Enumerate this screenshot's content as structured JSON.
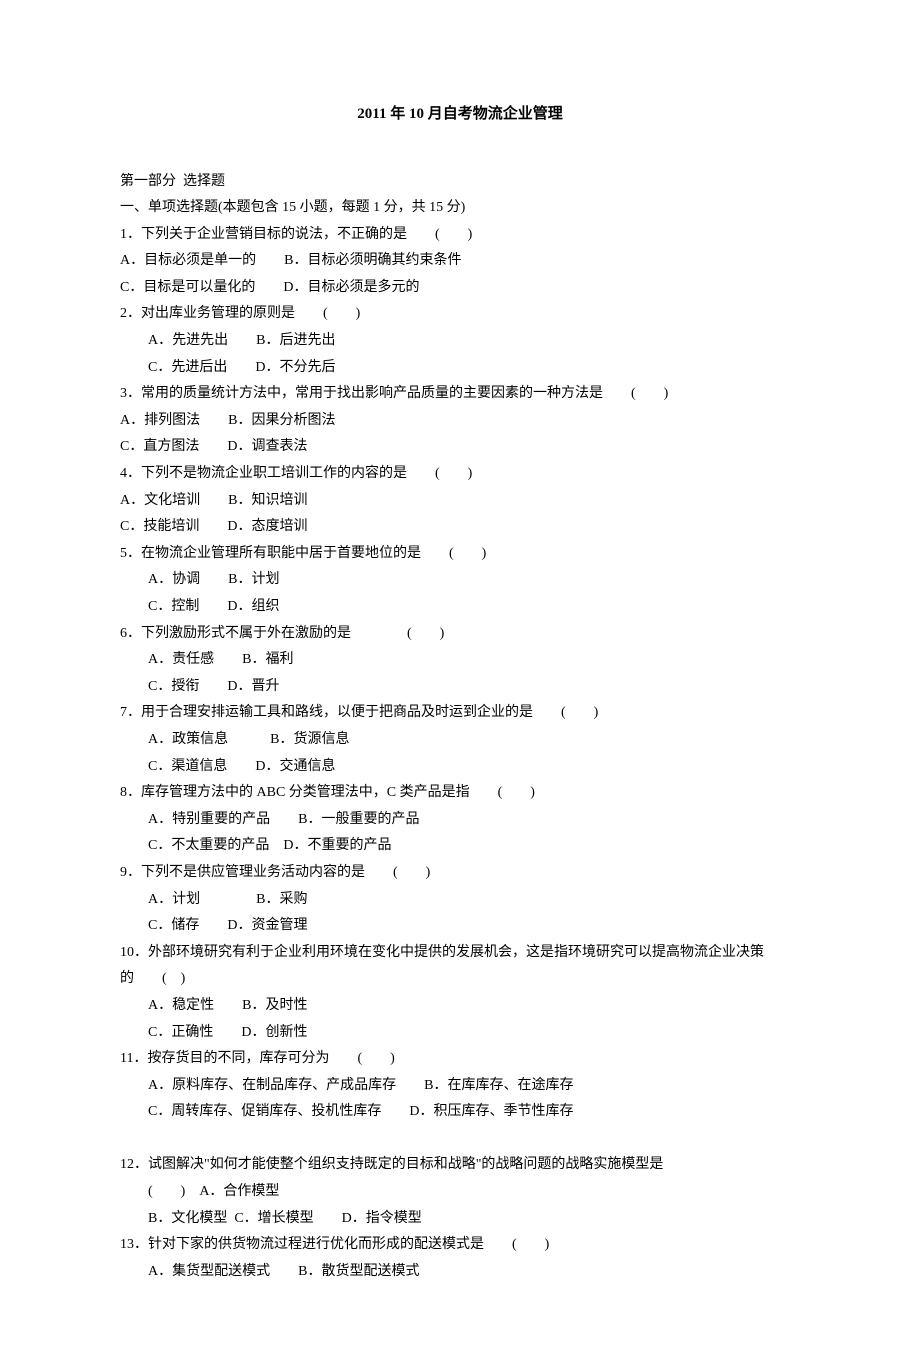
{
  "title": "2011 年 10 月自考物流企业管理",
  "part_header": "第一部分  选择题",
  "section1_header": "一、单项选择题(本题包含 15 小题，每题 1 分，共 15 分)",
  "q1": {
    "stem": "1．下列关于企业营销目标的说法，不正确的是　　(　　)",
    "line1": "A．目标必须是单一的　　B．目标必须明确其约束条件",
    "line2": "C．目标是可以量化的　　D．目标必须是多元的"
  },
  "q2": {
    "stem": "2．对出库业务管理的原则是　　(　　)",
    "line1": "A．先进先出　　B．后进先出",
    "line2": "C．先进后出　　D．不分先后"
  },
  "q3": {
    "stem": "3．常用的质量统计方法中，常用于找出影响产品质量的主要因素的一种方法是　　(　　)",
    "line1": "A．排列图法　　B．因果分析图法",
    "line2": "C．直方图法　　D．调查表法"
  },
  "q4": {
    "stem": "4．下列不是物流企业职工培训工作的内容的是　　(　　)",
    "line1": "A．文化培训　　B．知识培训",
    "line2": "C．技能培训　　D．态度培训"
  },
  "q5": {
    "stem": "5．在物流企业管理所有职能中居于首要地位的是　　(　　)",
    "line1": "A．协调　　B．计划",
    "line2": "C．控制　　D．组织"
  },
  "q6": {
    "stem": "6．下列激励形式不属于外在激励的是　　　　(　　)",
    "line1": "A．责任感　　B．福利",
    "line2": "C．授衔　　D．晋升"
  },
  "q7": {
    "stem": "7．用于合理安排运输工具和路线，以便于把商品及时运到企业的是　　(　　)",
    "line1": "A．政策信息　　　B．货源信息",
    "line2": "C．渠道信息　　D．交通信息"
  },
  "q8": {
    "stem": "8．库存管理方法中的 ABC 分类管理法中，C 类产品是指　　(　　)",
    "line1": "A．特别重要的产品　　B．一般重要的产品",
    "line2": "C．不太重要的产品　D．不重要的产品"
  },
  "q9": {
    "stem": "9．下列不是供应管理业务活动内容的是　　(　　)",
    "line1": "A．计划　　　　B．采购",
    "line2": "C．储存　　D．资金管理"
  },
  "q10": {
    "stem1": "10．外部环境研究有利于企业利用环境在变化中提供的发展机会，这是指环境研究可以提高物流企业决策",
    "stem2": "的　　(　)",
    "line1": "A．稳定性　　B．及时性",
    "line2": "C．正确性　　D．创新性"
  },
  "q11": {
    "stem": "11．按存货目的不同，库存可分为　　(　　)",
    "line1": "A．原料库存、在制品库存、产成品库存　　B．在库库存、在途库存",
    "line2": "C．周转库存、促销库存、投机性库存　　D．积压库存、季节性库存"
  },
  "q12": {
    "stem": "12．试图解决\"如何才能使整个组织支持既定的目标和战略\"的战略问题的战略实施模型是",
    "line1": "(　　)　A．合作模型",
    "line2": "B．文化模型  C．增长模型　　D．指令模型"
  },
  "q13": {
    "stem": "13．针对下家的供货物流过程进行优化而形成的配送模式是　　(　　)",
    "line1": "A．集货型配送模式　　B．散货型配送模式"
  }
}
